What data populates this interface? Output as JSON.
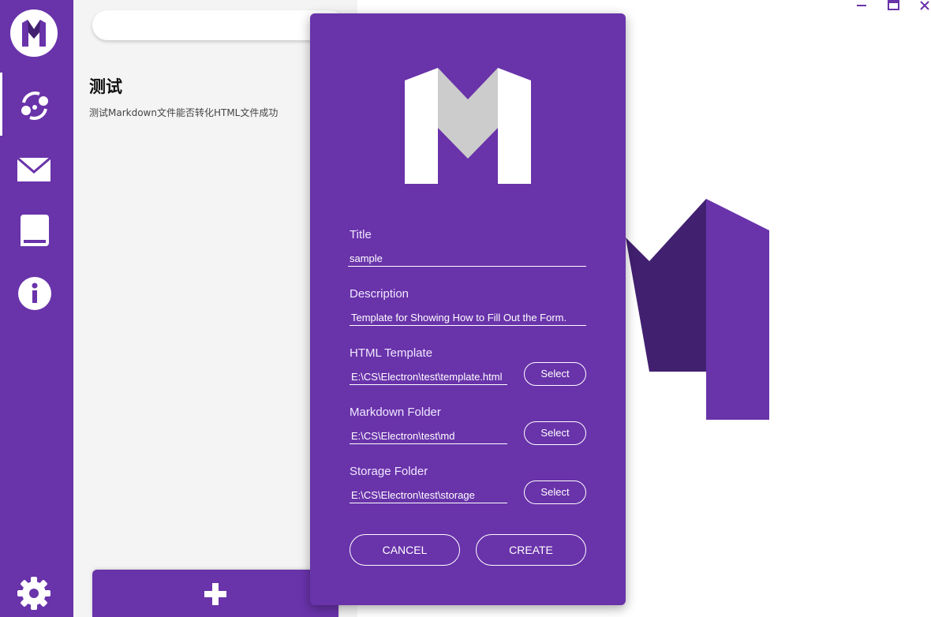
{
  "colors": {
    "primary": "#6933aa",
    "dark_accent": "#422070",
    "panel_bg": "#f4f4f4"
  },
  "sidebar": {
    "logo_icon": "app-logo-m",
    "items": [
      {
        "name": "sync",
        "icon": "sync-icon",
        "active": true
      },
      {
        "name": "mail",
        "icon": "mail-icon",
        "active": false
      },
      {
        "name": "book",
        "icon": "book-icon",
        "active": false
      },
      {
        "name": "info",
        "icon": "info-icon",
        "active": false
      }
    ],
    "settings_icon": "gear-icon"
  },
  "search": {
    "value": "",
    "placeholder": ""
  },
  "list": [
    {
      "title": "测试",
      "description": "测试Markdown文件能否转化HTML文件成功"
    }
  ],
  "add_button": {
    "icon": "plus-icon"
  },
  "window_controls": [
    "minimize-icon",
    "maximize-icon",
    "close-icon"
  ],
  "dialog": {
    "fields": {
      "title": {
        "label": "Title",
        "value": "sample"
      },
      "description": {
        "label": "Description",
        "value": "Template for Showing How to Fill Out the Form."
      },
      "html_template": {
        "label": "HTML Template",
        "value": "E:\\CS\\Electron\\test\\template.html",
        "button": "Select"
      },
      "markdown_folder": {
        "label": "Markdown Folder",
        "value": "E:\\CS\\Electron\\test\\md",
        "button": "Select"
      },
      "storage_folder": {
        "label": "Storage Folder",
        "value": "E:\\CS\\Electron\\test\\storage",
        "button": "Select"
      }
    },
    "cancel_label": "CANCEL",
    "create_label": "CREATE"
  }
}
